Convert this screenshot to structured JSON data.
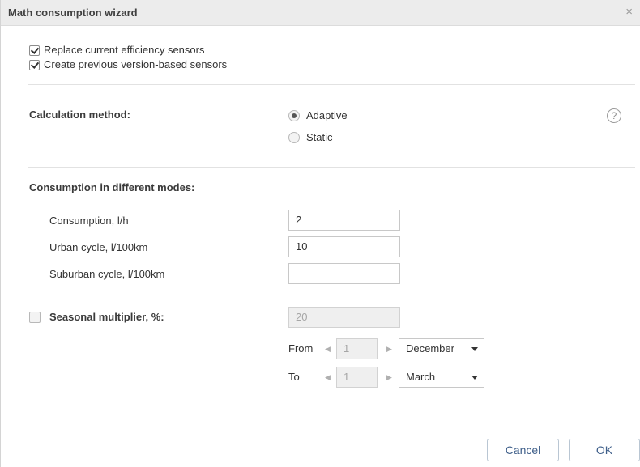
{
  "dialog": {
    "title": "Math consumption wizard",
    "close_glyph": "×"
  },
  "options": {
    "replace_sensors": {
      "label": "Replace current efficiency sensors",
      "checked": true
    },
    "create_sensors": {
      "label": "Create previous version-based sensors",
      "checked": true
    }
  },
  "calculation": {
    "label": "Calculation method:",
    "options": [
      {
        "label": "Adaptive",
        "selected": true
      },
      {
        "label": "Static",
        "selected": false
      }
    ],
    "help_glyph": "?"
  },
  "consumption": {
    "heading": "Consumption in different modes:",
    "fields": [
      {
        "label": "Consumption, l/h",
        "value": "2"
      },
      {
        "label": "Urban cycle, l/100km",
        "value": "10"
      },
      {
        "label": "Suburban cycle, l/100km",
        "value": ""
      }
    ]
  },
  "seasonal": {
    "label": "Seasonal multiplier, %:",
    "checked": false,
    "value": "20",
    "from": {
      "label": "From",
      "day": "1",
      "month": "December"
    },
    "to": {
      "label": "To",
      "day": "1",
      "month": "March"
    }
  },
  "buttons": {
    "cancel": "Cancel",
    "ok": "OK"
  },
  "icons": {
    "close": "close-icon",
    "help": "help-icon",
    "arrow_left": "arrow-left-icon",
    "arrow_right": "arrow-right-icon",
    "dropdown": "chevron-down-icon"
  }
}
